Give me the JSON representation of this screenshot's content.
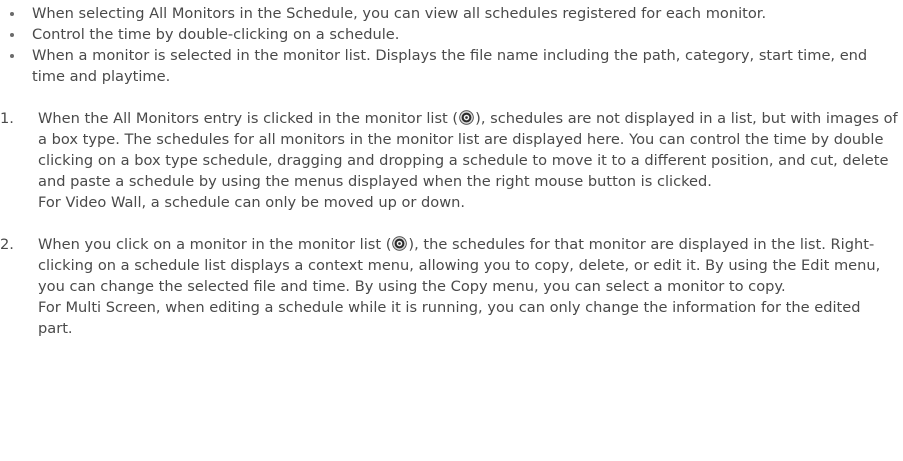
{
  "bullets": [
    {
      "text": "When selecting All Monitors in the Schedule, you can view all schedules registered for each monitor."
    },
    {
      "text": "Control the time by double-clicking on a schedule."
    },
    {
      "text": "When a monitor is selected in the monitor list. Displays the file name including the path, category, start time, end time and playtime."
    }
  ],
  "steps": [
    {
      "number": "1.",
      "text_before_icon": "When the All Monitors entry is clicked in the monitor list (",
      "icon": "monitor-list-icon",
      "text_after_icon": "), schedules are not displayed in a list, but with images of a box type. The schedules for all monitors in the monitor list are displayed here. You can control the time by double clicking on a box type schedule, dragging and dropping a schedule to move it to a different position, and cut, delete and paste a schedule by using the menus displayed when the right mouse button is clicked.",
      "note": "For Video Wall, a schedule can only be moved up or down."
    },
    {
      "number": "2.",
      "text_before_icon": "When you click on a monitor in the monitor list (",
      "icon": "monitor-list-icon",
      "text_after_icon": "), the schedules for that monitor are displayed in the list. Right-clicking on a schedule list displays a context menu, allowing you to copy, delete, or edit it. By using the Edit menu, you can change the selected file and time. By using the Copy menu, you can select a monitor to copy.",
      "note": "For Multi Screen, when editing a schedule while it is running, you can only change the information for the edited part."
    }
  ]
}
